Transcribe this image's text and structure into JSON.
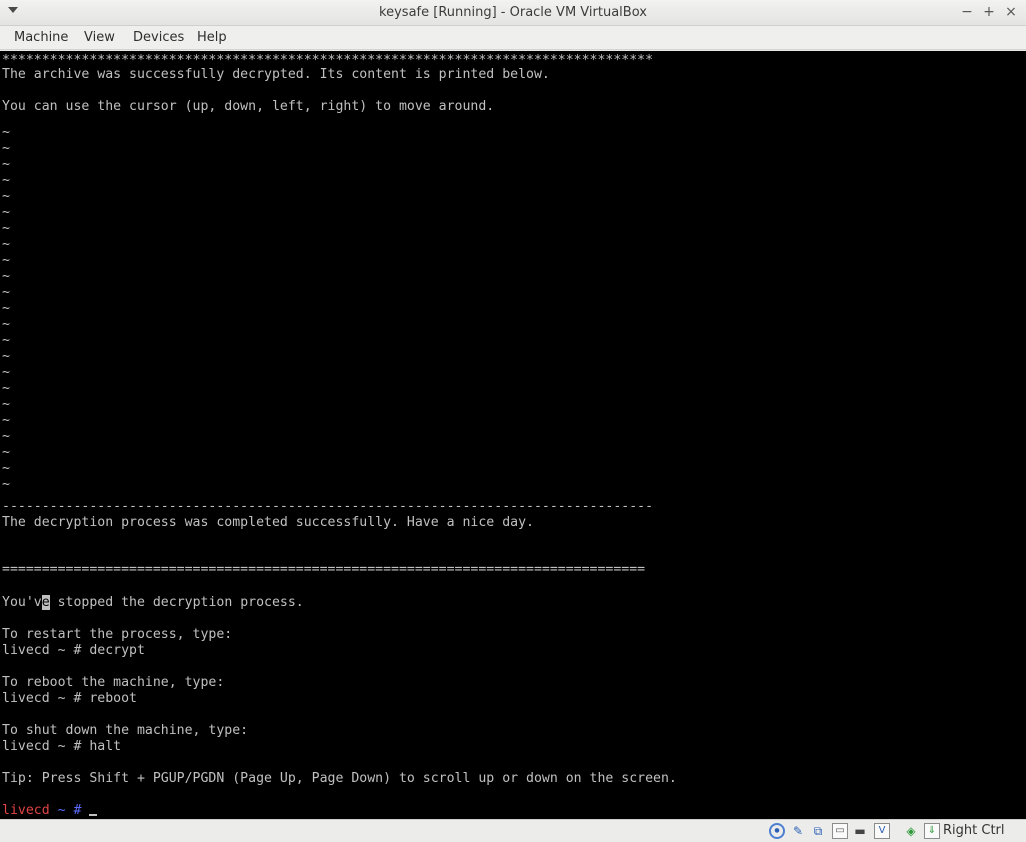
{
  "window": {
    "title": "keysafe [Running] - Oracle VM VirtualBox",
    "minimize_glyph": "−",
    "maximize_glyph": "+",
    "close_glyph": "×"
  },
  "menubar": {
    "machine": "Machine",
    "view": "View",
    "devices": "Devices",
    "help": "Help"
  },
  "terminal": {
    "star_rule": "**********************************************************************************",
    "archive_msg": "The archive was successfully decrypted. Its content is printed below.",
    "cursor_msg": "You can use the cursor (up, down, left, right) to move around.",
    "tilde": "~",
    "dash_rule": "----------------------------------------------------------------------------------",
    "completed_msg": "The decryption process was completed successfully. Have a nice day.",
    "equals_rule": "=================================================================================",
    "stopped_msg_a": "You'v",
    "stopped_msg_cursor": "e",
    "stopped_msg_b": " stopped the decryption process.",
    "restart_msg": "To restart the process, type:",
    "restart_cmd": "livecd ~ # decrypt",
    "reboot_msg": "To reboot the machine, type:",
    "reboot_cmd": "livecd ~ # reboot",
    "shutdown_msg": "To shut down the machine, type:",
    "shutdown_cmd": "livecd ~ # halt",
    "tip": "Tip: Press Shift + PGUP/PGDN (Page Up, Page Down) to scroll up or down on the screen.",
    "prompt_host": "livecd",
    "prompt_path": " ~ # "
  },
  "statusbar": {
    "icons": [
      "optical-drive-icon",
      "usb-icon",
      "network-icon",
      "shared-folders-icon",
      "display-icon",
      "video-capture-icon",
      "virtualization-icon",
      "mouse-integration-icon"
    ],
    "host_key": "Right Ctrl"
  }
}
